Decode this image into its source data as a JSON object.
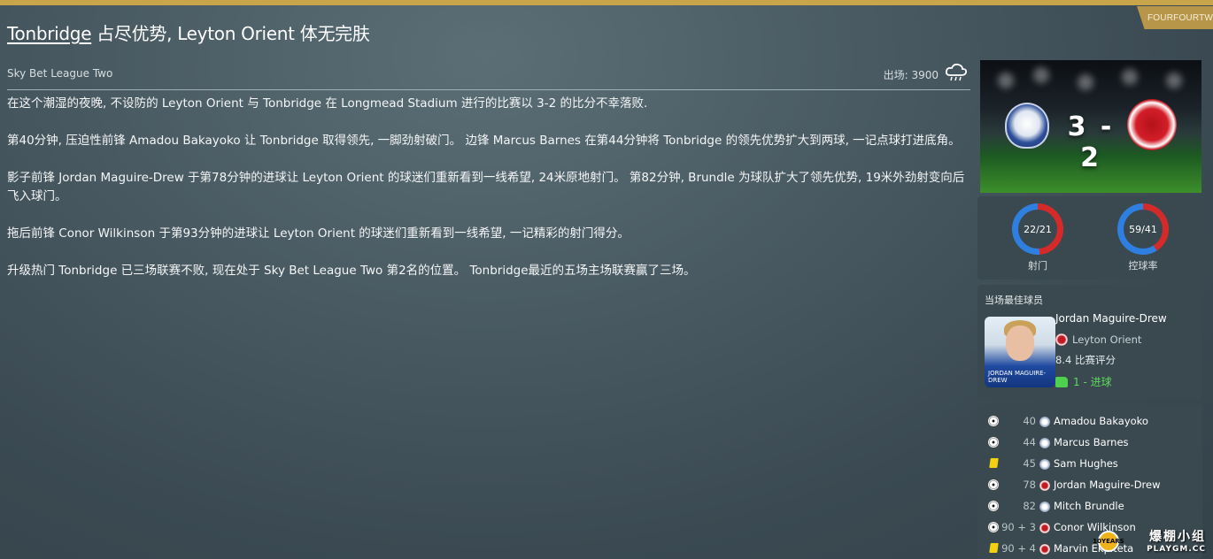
{
  "brand": "FOURFOURTWO",
  "headline": {
    "team1": "Tonbridge",
    "part1": "占尽优势,",
    "team2": "Leyton Orient",
    "part2": "体无完肤"
  },
  "meta": {
    "league": "Sky Bet League Two",
    "attendance": "出场: 3900",
    "weather_icon": "rain-cloud-icon"
  },
  "report": [
    "在这个潮湿的夜晚, 不设防的 Leyton Orient 与 Tonbridge 在 Longmead Stadium 进行的比赛以 3-2 的比分不幸落败.",
    "第40分钟, 压迫性前锋 Amadou Bakayoko 让 Tonbridge 取得领先, 一脚劲射破门。 边锋 Marcus Barnes 在第44分钟将 Tonbridge 的领先优势扩大到两球, 一记点球打进底角。",
    "影子前锋 Jordan Maguire-Drew 于第78分钟的进球让 Leyton Orient 的球迷们重新看到一线希望, 24米原地射门。 第82分钟, Brundle 为球队扩大了领先优势, 19米外劲射变向后飞入球门。",
    "拖后前锋 Conor Wilkinson 于第93分钟的进球让 Leyton Orient 的球迷们重新看到一线希望, 一记精彩的射门得分。",
    "升级热门 Tonbridge 已三场联赛不败, 现在处于 Sky Bet League Two 第2名的位置。 Tonbridge最近的五场主场联赛赢了三场。"
  ],
  "score": {
    "display": "3 - 2",
    "home": 3,
    "away": 2
  },
  "stats": [
    {
      "value": "22/21",
      "label": "射门",
      "home": 22,
      "away": 21
    },
    {
      "value": "59/41",
      "label": "控球率",
      "home": 59,
      "away": 41
    }
  ],
  "colors": {
    "home": "#2f7fe0",
    "away": "#d42a2a",
    "accent": "#c8a44a",
    "goal_green": "#5ad85a"
  },
  "potm": {
    "title": "当场最佳球员",
    "name": "Jordan Maguire-Drew",
    "club": "Leyton Orient",
    "rating": "8.4",
    "rating_label": "比赛评分",
    "goals": "1 - 进球",
    "photo_caption": "JORDAN MAGUIRE-DREW"
  },
  "events": [
    {
      "type": "goal",
      "icon": "ball-icon",
      "minute": "40",
      "team": "home",
      "player": "Amadou Bakayoko"
    },
    {
      "type": "goal",
      "icon": "ball-icon",
      "minute": "44",
      "team": "home",
      "player": "Marcus Barnes"
    },
    {
      "type": "yellow",
      "icon": "yellow-card-icon",
      "minute": "45",
      "team": "home",
      "player": "Sam Hughes"
    },
    {
      "type": "goal",
      "icon": "ball-icon",
      "minute": "78",
      "team": "away",
      "player": "Jordan Maguire-Drew"
    },
    {
      "type": "goal",
      "icon": "ball-icon",
      "minute": "82",
      "team": "home",
      "player": "Mitch Brundle"
    },
    {
      "type": "goal",
      "icon": "ball-icon",
      "minute": "90 + 3",
      "team": "away",
      "player": "Conor Wilkinson"
    },
    {
      "type": "yellow",
      "icon": "yellow-card-icon",
      "minute": "90 + 4",
      "team": "away",
      "player": "Marvin Ekpiteta"
    }
  ],
  "watermark": {
    "top": "爆棚小组",
    "bottom": "PLAYGM.CC",
    "badge": "10YEARS"
  }
}
